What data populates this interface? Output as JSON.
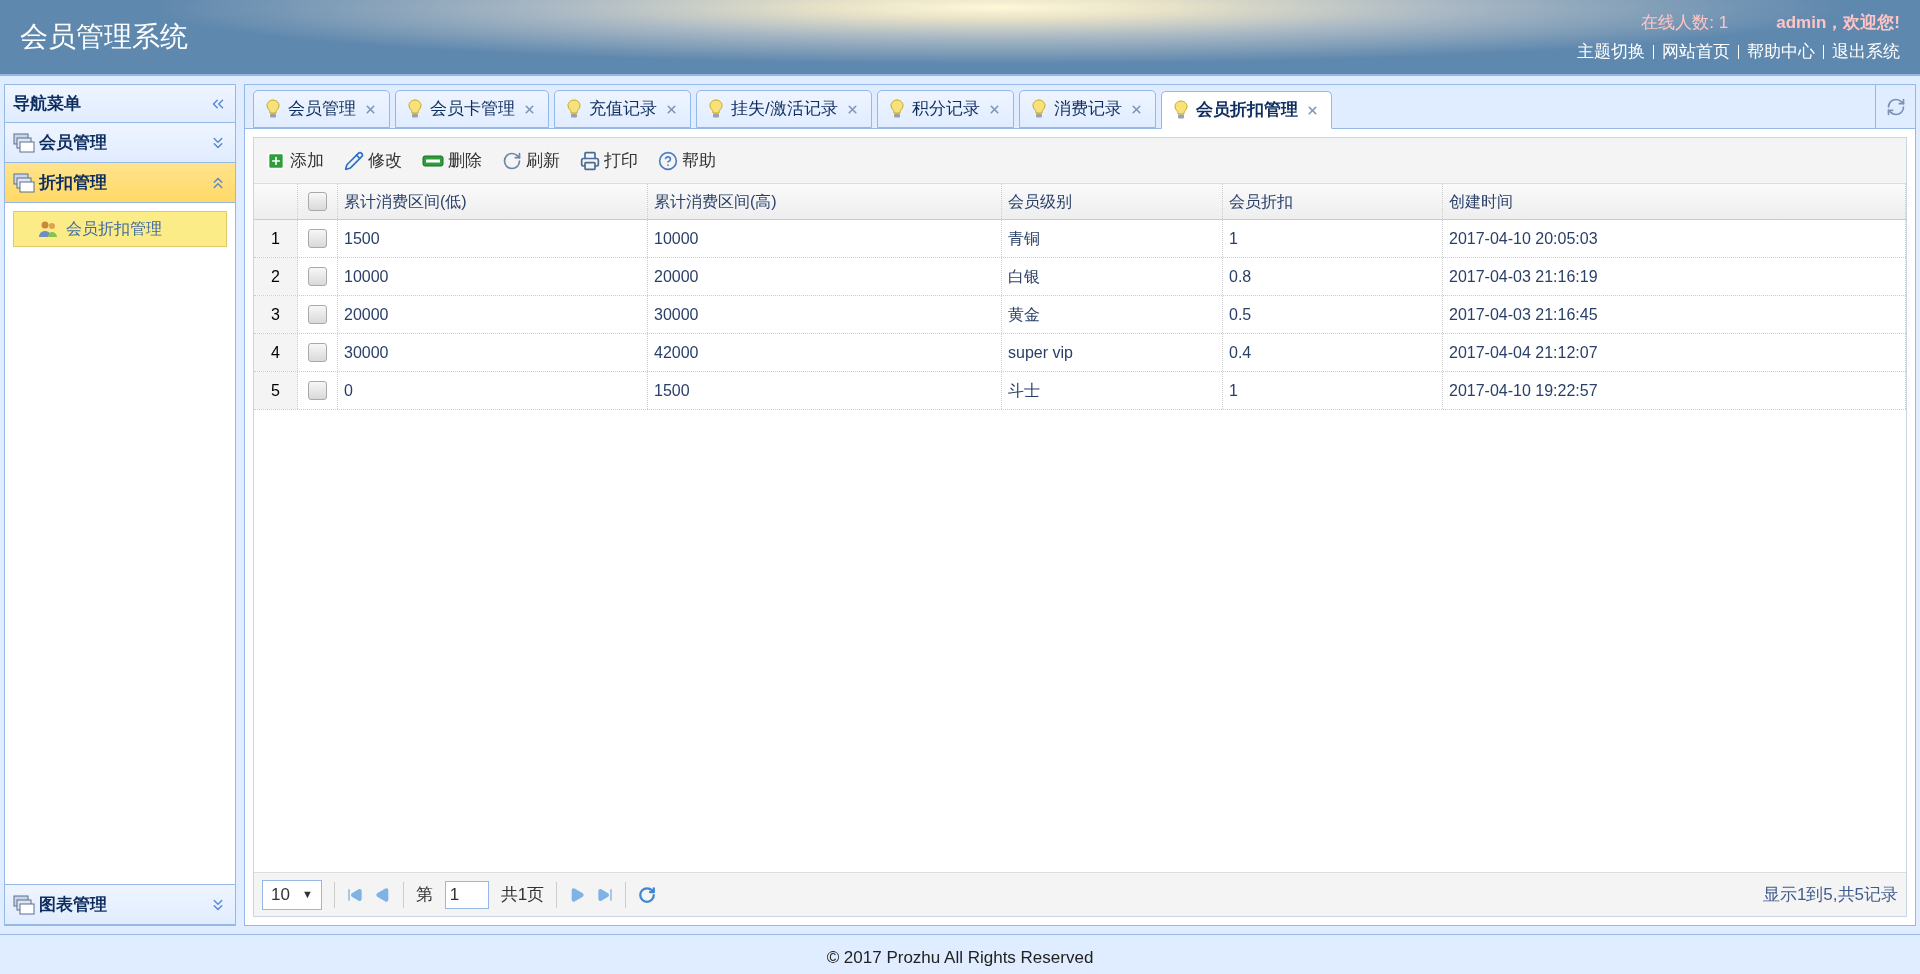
{
  "header": {
    "title": "会员管理系统",
    "online": "在线人数: 1",
    "greeting": "admin，欢迎您!",
    "links": [
      "主题切换",
      "网站首页",
      "帮助中心",
      "退出系统"
    ]
  },
  "sidebar": {
    "title": "导航菜单",
    "sections": [
      {
        "label": "会员管理",
        "expanded": false
      },
      {
        "label": "折扣管理",
        "expanded": true,
        "items": [
          {
            "label": "会员折扣管理",
            "selected": true
          }
        ]
      },
      {
        "label": "图表管理",
        "expanded": false
      }
    ]
  },
  "tabs": [
    {
      "label": "会员管理",
      "selected": false
    },
    {
      "label": "会员卡管理",
      "selected": false
    },
    {
      "label": "充值记录",
      "selected": false
    },
    {
      "label": "挂失/激活记录",
      "selected": false
    },
    {
      "label": "积分记录",
      "selected": false
    },
    {
      "label": "消费记录",
      "selected": false
    },
    {
      "label": "会员折扣管理",
      "selected": true
    }
  ],
  "toolbar": [
    {
      "kind": "add",
      "label": "添加"
    },
    {
      "kind": "edit",
      "label": "修改"
    },
    {
      "kind": "delete",
      "label": "删除"
    },
    {
      "kind": "refresh",
      "label": "刷新"
    },
    {
      "kind": "print",
      "label": "打印"
    },
    {
      "kind": "help",
      "label": "帮助"
    }
  ],
  "table": {
    "all_checked": false,
    "columns": [
      "累计消费区间(低)",
      "累计消费区间(高)",
      "会员级别",
      "会员折扣",
      "创建时间"
    ],
    "rows": [
      {
        "number": "1",
        "checked": false,
        "cells": [
          "1500",
          "10000",
          "青铜",
          "1",
          "2017-04-10 20:05:03"
        ]
      },
      {
        "number": "2",
        "checked": false,
        "cells": [
          "10000",
          "20000",
          "白银",
          "0.8",
          "2017-04-03 21:16:19"
        ]
      },
      {
        "number": "3",
        "checked": false,
        "cells": [
          "20000",
          "30000",
          "黄金",
          "0.5",
          "2017-04-03 21:16:45"
        ]
      },
      {
        "number": "4",
        "checked": false,
        "cells": [
          "30000",
          "42000",
          "super vip",
          "0.4",
          "2017-04-04 21:12:07"
        ]
      },
      {
        "number": "5",
        "checked": false,
        "cells": [
          "0",
          "1500",
          "斗士",
          "1",
          "2017-04-10 19:22:57"
        ]
      }
    ]
  },
  "pager": {
    "page_size": "10",
    "dropdown_arrow": "▼",
    "page_prefix": "第",
    "page": "1",
    "page_suffix": "共1页",
    "summary": "显示1到5,共5记录"
  },
  "footer": "© 2017 Prozhu All Rights Reserved"
}
